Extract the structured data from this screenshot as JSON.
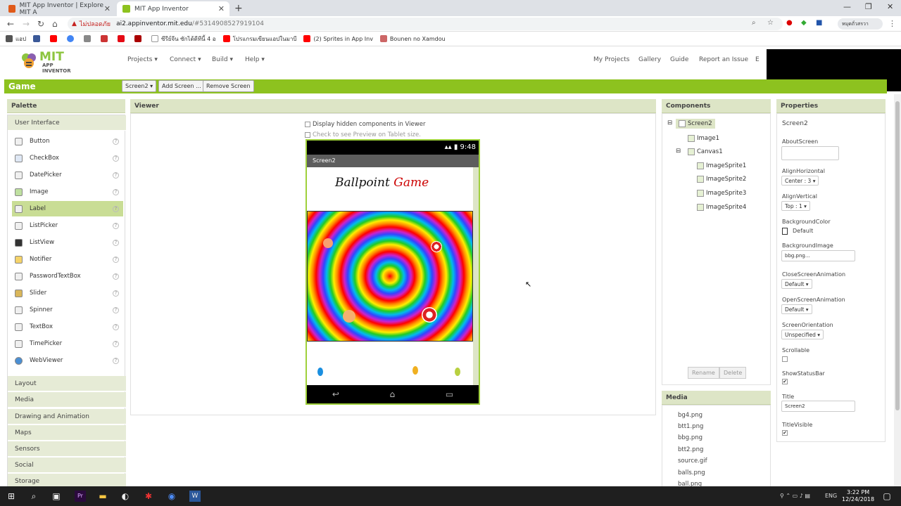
{
  "browser": {
    "tabs": [
      {
        "title": "MIT App Inventor | Explore MIT A"
      },
      {
        "title": "MIT App Inventor"
      }
    ],
    "address": {
      "insecure_label": "ไม่ปลอดภัย",
      "host": "ai2.appinventor.mit.edu",
      "path": "/#5314908527919104"
    },
    "profile_label": "หมุดถั่วสรวา",
    "bookmarks": [
      {
        "label": "แอป"
      },
      {
        "label": ""
      },
      {
        "label": ""
      },
      {
        "label": ""
      },
      {
        "label": "ซีรีย์จีน ซักได้ดีทีนี้ 4 อ"
      },
      {
        "label": "โปรแกรมเขียนแอปในมาบี"
      },
      {
        "label": "(2) Sprites in App Inv"
      },
      {
        "label": "Bounen no Xamdou"
      }
    ]
  },
  "header": {
    "logo_main": "MIT",
    "logo_sub": "APP INVENTOR",
    "menus": [
      "Projects ▾",
      "Connect ▾",
      "Build ▾",
      "Help ▾"
    ],
    "links": [
      "My Projects",
      "Gallery",
      "Guide",
      "Report an Issue",
      "E"
    ]
  },
  "project": {
    "name": "Game",
    "screen_dropdown": "Screen2 ▾",
    "add_screen": "Add Screen ...",
    "remove_screen": "Remove Screen"
  },
  "palette": {
    "title": "Palette",
    "category_open": "User Interface",
    "items": [
      "Button",
      "CheckBox",
      "DatePicker",
      "Image",
      "Label",
      "ListPicker",
      "ListView",
      "Notifier",
      "PasswordTextBox",
      "Slider",
      "Spinner",
      "TextBox",
      "TimePicker",
      "WebViewer"
    ],
    "selected": "Label",
    "categories": [
      "Layout",
      "Media",
      "Drawing and Animation",
      "Maps",
      "Sensors",
      "Social",
      "Storage"
    ],
    "help_glyph": "?"
  },
  "viewer": {
    "title": "Viewer",
    "hidden_label": "Display hidden components in Viewer",
    "tablet_label": "Check to see Preview on Tablet size.",
    "phone_time": "9:48",
    "screen_title": "Screen2",
    "game_title_a": "Ballpoint",
    "game_title_b": "Game"
  },
  "components": {
    "title": "Components",
    "tree": [
      "Screen2",
      "Image1",
      "Canvas1",
      "ImageSprite1",
      "ImageSprite2",
      "ImageSprite3",
      "ImageSprite4"
    ],
    "rename": "Rename",
    "delete": "Delete"
  },
  "media": {
    "title": "Media",
    "files": [
      "bg4.png",
      "btt1.png",
      "bbg.png",
      "btt2.png",
      "source.gif",
      "balls.png",
      "ball.png"
    ]
  },
  "properties": {
    "title": "Properties",
    "component": "Screen2",
    "about_label": "AboutScreen",
    "align_h_label": "AlignHorizontal",
    "align_h_value": "Center : 3 ▾",
    "align_v_label": "AlignVertical",
    "align_v_value": "Top : 1 ▾",
    "bgcolor_label": "BackgroundColor",
    "bgcolor_value": "Default",
    "bgimage_label": "BackgroundImage",
    "bgimage_value": "bbg.png...",
    "close_anim_label": "CloseScreenAnimation",
    "close_anim_value": "Default ▾",
    "open_anim_label": "OpenScreenAnimation",
    "open_anim_value": "Default ▾",
    "orientation_label": "ScreenOrientation",
    "orientation_value": "Unspecified ▾",
    "scrollable_label": "Scrollable",
    "statusbar_label": "ShowStatusBar",
    "title_label": "Title",
    "title_value": "Screen2",
    "titlevisible_label": "TitleVisible",
    "check_glyph": "✔"
  },
  "taskbar": {
    "lang": "ENG",
    "time": "3:22 PM",
    "date": "12/24/2018"
  },
  "colors": {
    "brand_green": "#8dc21f",
    "panel_header": "#dde5c6"
  }
}
